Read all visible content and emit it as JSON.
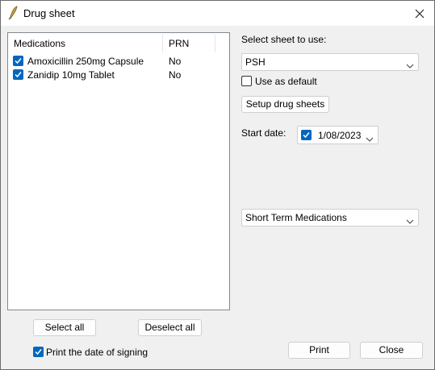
{
  "window": {
    "title": "Drug sheet",
    "icon": "pen-nib-icon",
    "close_icon": "close-icon"
  },
  "list": {
    "columns": [
      "Medications",
      "PRN"
    ],
    "rows": [
      {
        "medication": "Amoxicillin 250mg Capsule",
        "prn": "No",
        "checked": true
      },
      {
        "medication": "Zanidip 10mg Tablet",
        "prn": "No",
        "checked": true
      }
    ]
  },
  "buttons": {
    "select_all": "Select all",
    "deselect_all": "Deselect all",
    "setup": "Setup drug sheets",
    "print": "Print",
    "close": "Close"
  },
  "options": {
    "print_date_label": "Print the date of signing",
    "print_date_checked": true,
    "use_default_label": "Use as default",
    "use_default_checked": false
  },
  "sheet": {
    "label": "Select sheet to use:",
    "value": "PSH"
  },
  "start_date": {
    "label": "Start date:",
    "value": "1/08/2023",
    "checked": true
  },
  "category": {
    "value": "Short Term Medications"
  },
  "colors": {
    "accent": "#0067c0",
    "dialog_bg": "#f0f0f0"
  }
}
